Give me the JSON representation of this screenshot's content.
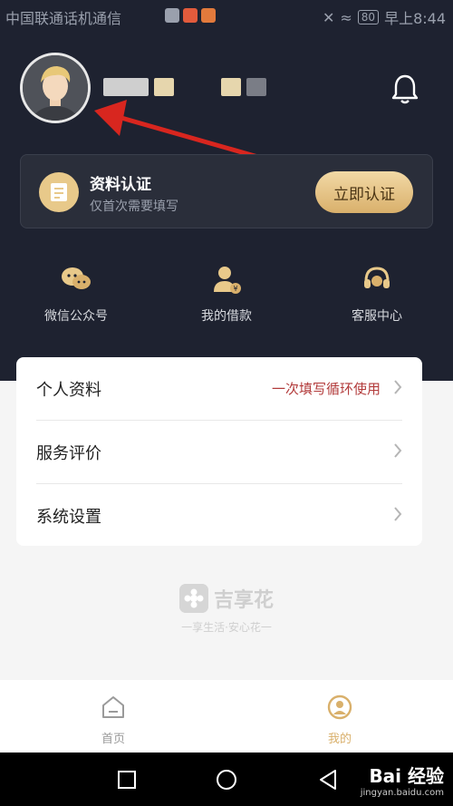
{
  "status_bar": {
    "carrier": "中国联通话机通信",
    "battery": "80",
    "time": "早上8:44"
  },
  "profile": {
    "avatar_icon": "user-avatar",
    "bell_icon": "bell-icon"
  },
  "verify_card": {
    "title": "资料认证",
    "subtitle": "仅首次需要填写",
    "button": "立即认证",
    "icon": "id-card-icon"
  },
  "quick_links": [
    {
      "label": "微信公众号",
      "icon": "wechat-icon"
    },
    {
      "label": "我的借款",
      "icon": "loan-icon"
    },
    {
      "label": "客服中心",
      "icon": "headset-icon"
    }
  ],
  "menu": [
    {
      "label": "个人资料",
      "extra": "一次填写循环使用"
    },
    {
      "label": "服务评价",
      "extra": ""
    },
    {
      "label": "系统设置",
      "extra": ""
    }
  ],
  "brand": {
    "name": "吉享花",
    "slogan": "一享生活·安心花一"
  },
  "tabs": [
    {
      "label": "首页",
      "icon": "home-icon",
      "active": false
    },
    {
      "label": "我的",
      "icon": "profile-icon",
      "active": true
    }
  ],
  "colors": {
    "header_bg": "#1e2230",
    "accent_gold": "#d9b06b",
    "highlight_red": "#b23a3a"
  },
  "watermark": {
    "text": "Bai 经验",
    "sub": "jingyan.baidu.com"
  }
}
